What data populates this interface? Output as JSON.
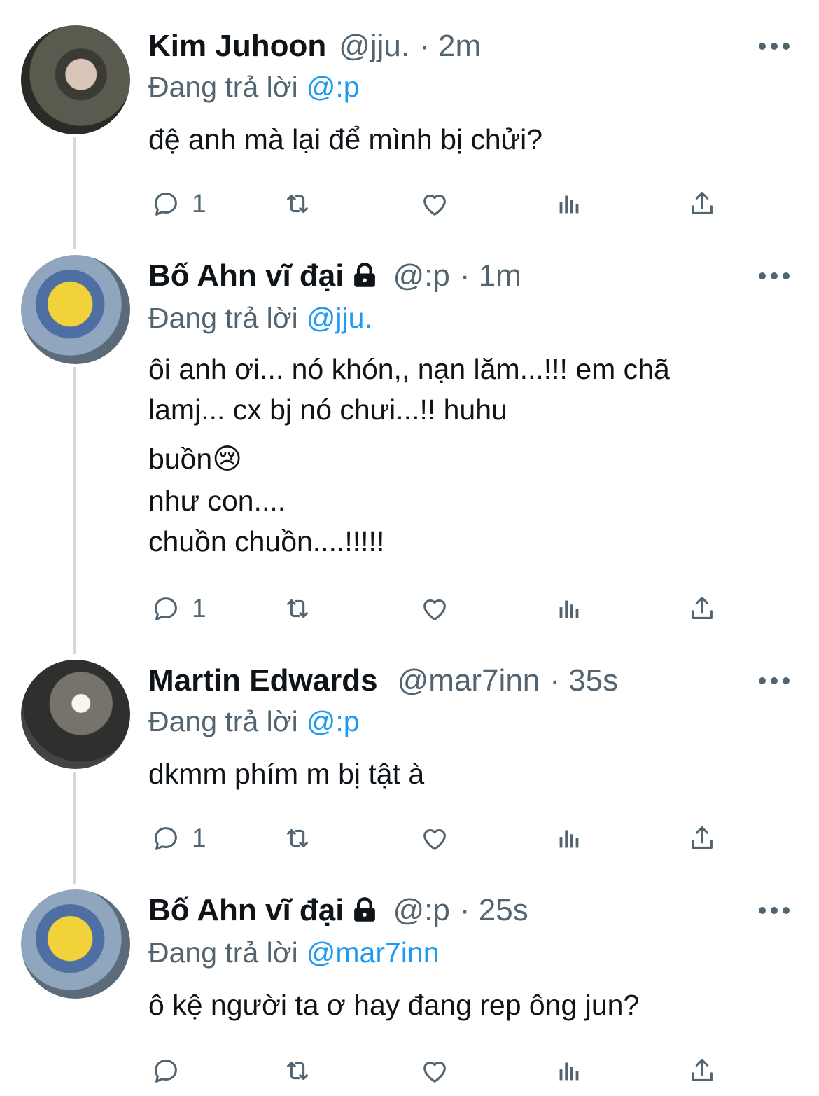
{
  "tweets": [
    {
      "name": "Kim Juhoon",
      "handle": "@jju.",
      "time": "· 2m",
      "reply_prefix": "Đang trả lời",
      "reply_to": "@:p",
      "lines": [
        "đệ anh mà lại để mình bị chửi?"
      ],
      "reply_count": "1",
      "avatar": "photo-boy-avatar"
    },
    {
      "name": "Bố Ahn vĩ đại",
      "handle": "@:p",
      "time": "· 1m",
      "reply_prefix": "Đang trả lời",
      "reply_to": "@jju.",
      "lines": [
        "ôi anh ơi... nó khón,, nạn lăm...!!! em chã",
        "lamj... cx bj nó chưi...!! huhu",
        "buồn😢",
        "như con....",
        "chuồn chuồn....!!!!!"
      ],
      "reply_count": "1",
      "locked": true,
      "avatar": "minion-avatar"
    },
    {
      "name": "Martin Edwards",
      "handle": "@mar7inn",
      "time": "· 35s",
      "reply_prefix": "Đang trả lời",
      "reply_to": "@:p",
      "lines": [
        "dkmm phím m bị tật à"
      ],
      "reply_count": "1",
      "avatar": "mirror-selfie-avatar"
    },
    {
      "name": "Bố Ahn vĩ đại",
      "handle": "@:p",
      "time": "· 25s",
      "reply_prefix": "Đang trả lời",
      "reply_to": "@mar7inn",
      "lines": [
        "ô kệ người ta ơ hay đang rep ông jun?"
      ],
      "reply_count": "",
      "locked": true,
      "avatar": "minion-avatar"
    }
  ],
  "icons": [
    "reply-icon",
    "retweet-icon",
    "like-icon",
    "analytics-icon",
    "share-icon",
    "lock-icon",
    "more-icon"
  ],
  "colors": {
    "text": "#0f1419",
    "secondary": "#536471",
    "accent": "#1d9bf0",
    "thread_line": "#cfd9de"
  }
}
